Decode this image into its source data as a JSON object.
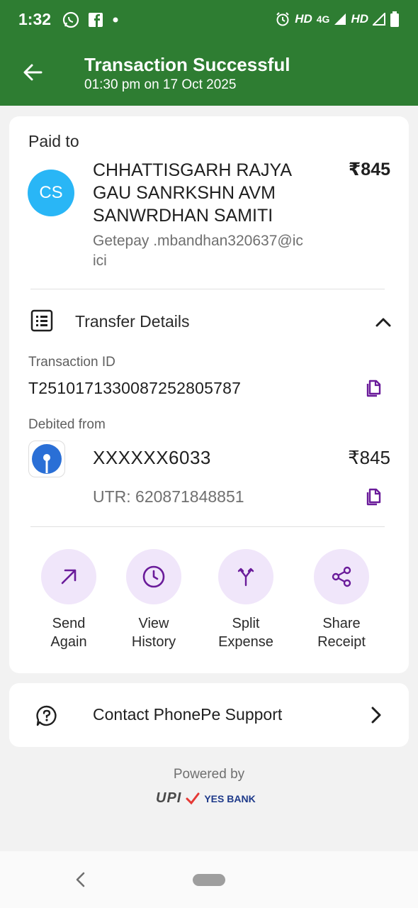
{
  "status_bar": {
    "time": "1:32",
    "hd1": "HD",
    "net": "4G",
    "hd2": "HD"
  },
  "header": {
    "title": "Transaction Successful",
    "subtitle": "01:30 pm on 17 Oct 2025"
  },
  "payee": {
    "section_label": "Paid to",
    "initials": "CS",
    "avatar_color": "#29b6f6",
    "name": "CHHATTISGARH RAJYA GAU SANRKSHN AVM SANWRDHAN SAMITI",
    "upi_id": "Getepay .mbandhan320637@icici",
    "amount": "₹845"
  },
  "transfer": {
    "label": "Transfer Details",
    "transaction_id_label": "Transaction ID",
    "transaction_id": "T2510171330087252805787",
    "debited_from_label": "Debited from",
    "account": "XXXXXX6033",
    "amount": "₹845",
    "utr": "UTR: 620871848851"
  },
  "actions": [
    {
      "label_line1": "Send",
      "label_line2": "Again",
      "icon": "arrow-up-right-icon"
    },
    {
      "label_line1": "View",
      "label_line2": "History",
      "icon": "clock-icon"
    },
    {
      "label_line1": "Split",
      "label_line2": "Expense",
      "icon": "split-icon"
    },
    {
      "label_line1": "Share",
      "label_line2": "Receipt",
      "icon": "share-icon"
    }
  ],
  "support": {
    "label": "Contact PhonePe Support"
  },
  "footer": {
    "powered_by": "Powered by",
    "upi": "UPI",
    "bank": "YES BANK"
  },
  "colors": {
    "header_green": "#2e7d32",
    "accent_purple": "#6a1b9a",
    "action_bg": "#f0e6fa"
  }
}
